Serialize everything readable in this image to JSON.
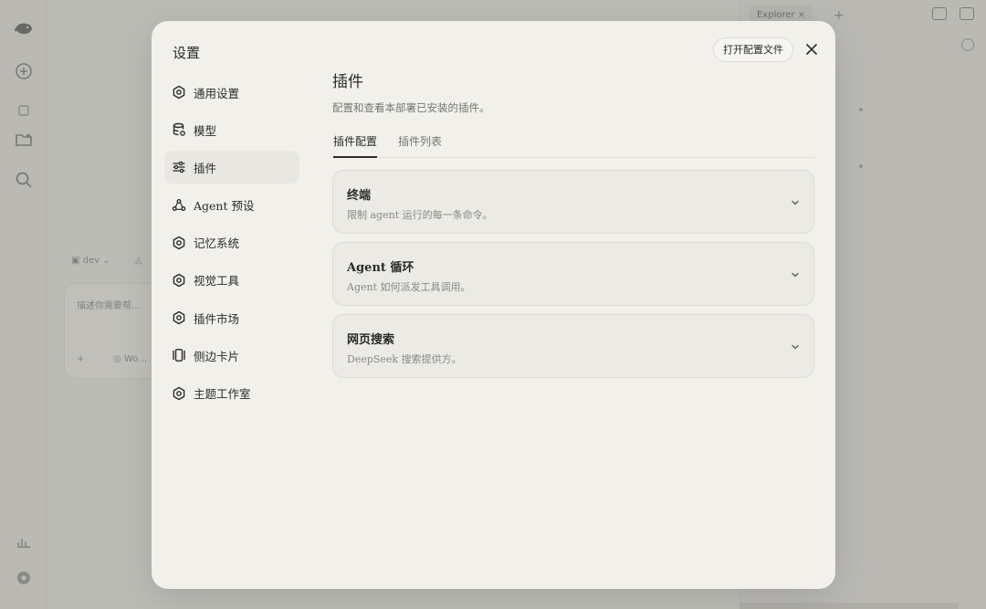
{
  "background_app": {
    "right_tab_label": "Explorer  ×",
    "right_tab_plus": "+",
    "card_chip_1": "▣ dev ⌄",
    "card_chip_2": "◬",
    "card_placeholder": "描述你需要帮…",
    "card_plus": "+",
    "card_btn": "◎ Wo…"
  },
  "modal": {
    "title": "设置",
    "open_config_label": "打开配置文件"
  },
  "sidebar": {
    "items": [
      {
        "label": "通用设置",
        "icon": "gear-icon"
      },
      {
        "label": "模型",
        "icon": "database-icon"
      },
      {
        "label": "插件",
        "icon": "sliders-icon"
      },
      {
        "label": "Agent 预设",
        "icon": "agent-icon"
      },
      {
        "label": "记忆系统",
        "icon": "gear-icon"
      },
      {
        "label": "视觉工具",
        "icon": "gear-icon"
      },
      {
        "label": "插件市场",
        "icon": "gear-icon"
      },
      {
        "label": "侧边卡片",
        "icon": "panel-icon"
      },
      {
        "label": "主题工作室",
        "icon": "gear-icon"
      }
    ],
    "active_index": 2
  },
  "main": {
    "title": "插件",
    "description": "配置和查看本部署已安装的插件。",
    "tabs": [
      {
        "label": "插件配置",
        "active": true
      },
      {
        "label": "插件列表",
        "active": false
      }
    ],
    "cards": [
      {
        "title": "终端",
        "description": "限制 agent 运行的每一条命令。"
      },
      {
        "title": "Agent 循环",
        "description": "Agent 如何派发工具调用。"
      },
      {
        "title": "网页搜索",
        "description": "DeepSeek 搜索提供方。"
      }
    ]
  },
  "colors": {
    "modal_bg": "#f1f0eb",
    "card_bg": "#ebeae5",
    "text": "#2b2a27",
    "muted": "#76756f",
    "active_nav": "#e8e7e2"
  }
}
